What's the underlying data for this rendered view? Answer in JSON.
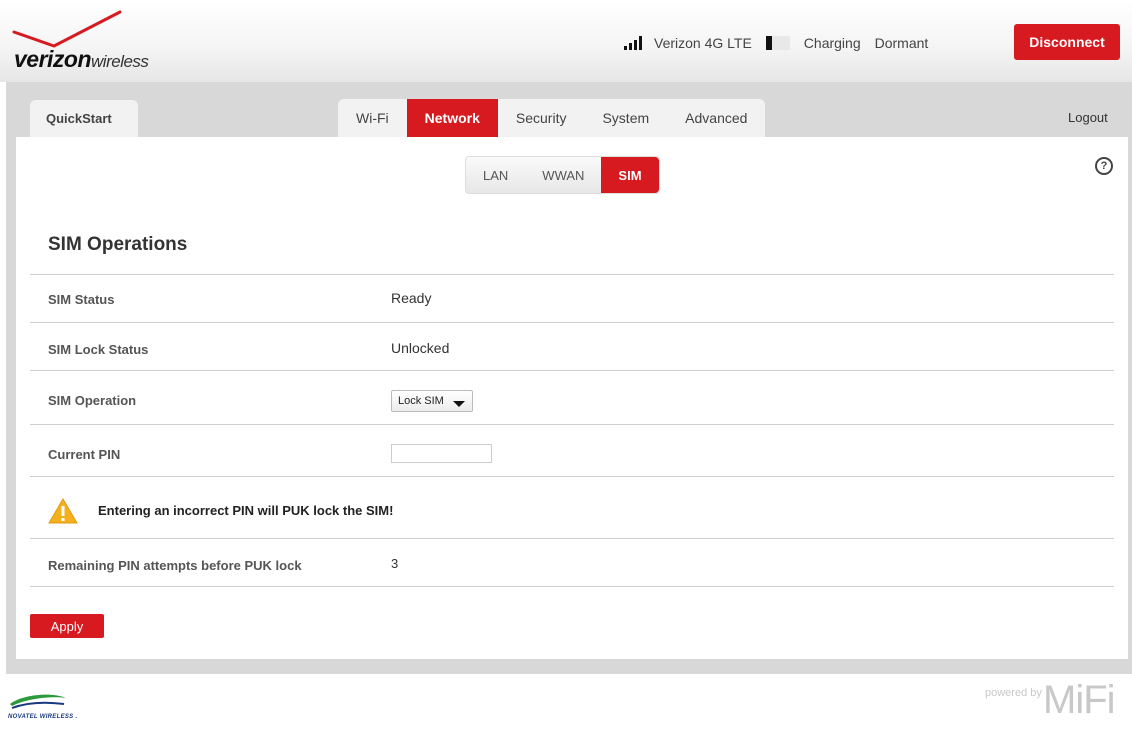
{
  "header": {
    "logo_bold": "verizon",
    "logo_light": "wireless",
    "network": "Verizon 4G LTE",
    "battery_status": "Charging",
    "connection_state": "Dormant",
    "disconnect_label": "Disconnect",
    "signal_icon": "signal-bars-icon",
    "battery_icon": "battery-icon"
  },
  "nav": {
    "quickstart": "QuickStart",
    "tabs": [
      {
        "label": "Wi-Fi"
      },
      {
        "label": "Network"
      },
      {
        "label": "Security"
      },
      {
        "label": "System"
      },
      {
        "label": "Advanced"
      }
    ],
    "active_tab": "Network",
    "logout": "Logout"
  },
  "subnav": {
    "tabs": [
      {
        "label": "LAN"
      },
      {
        "label": "WWAN"
      },
      {
        "label": "SIM"
      }
    ],
    "active": "SIM",
    "help_icon": "?"
  },
  "main": {
    "title": "SIM Operations",
    "rows": [
      {
        "label": "SIM Status",
        "value": "Ready"
      },
      {
        "label": "SIM Lock Status",
        "value": "Unlocked"
      },
      {
        "label": "SIM Operation",
        "value": "Lock SIM"
      },
      {
        "label": "Current PIN",
        "value": ""
      }
    ],
    "warning": "Entering an incorrect PIN will PUK lock the SIM!",
    "attempts_label": "Remaining PIN attempts before PUK lock",
    "attempts_value": "3",
    "apply_label": "Apply"
  },
  "footer": {
    "left_logo_text": "NOVATEL WIRELESS .",
    "right_logo_small": "powered by",
    "right_logo_big": "MiFi"
  },
  "colors": {
    "accent": "#d71920",
    "frame": "#d8d8d8"
  }
}
